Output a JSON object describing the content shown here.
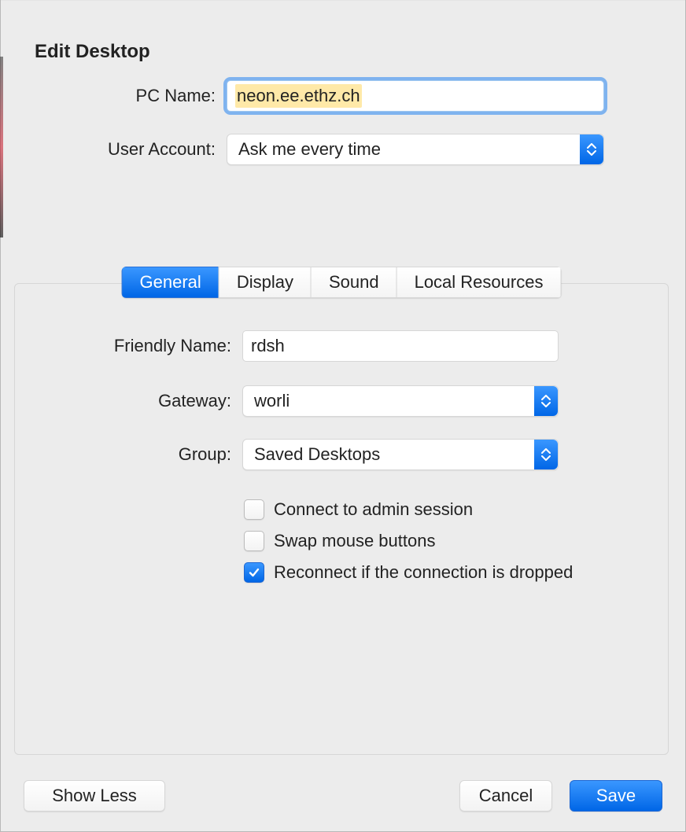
{
  "title": "Edit Desktop",
  "fields": {
    "pc_name": {
      "label": "PC Name:",
      "value": "neon.ee.ethz.ch"
    },
    "user_account": {
      "label": "User Account:",
      "value": "Ask me every time"
    }
  },
  "tabs": {
    "general": "General",
    "display": "Display",
    "sound": "Sound",
    "local_resources": "Local Resources",
    "active": "general"
  },
  "general": {
    "friendly_name": {
      "label": "Friendly Name:",
      "value": "rdsh"
    },
    "gateway": {
      "label": "Gateway:",
      "value": "worli"
    },
    "group": {
      "label": "Group:",
      "value": "Saved Desktops"
    },
    "checkboxes": {
      "admin_session": {
        "label": "Connect to admin session",
        "checked": false
      },
      "swap_mouse": {
        "label": "Swap mouse buttons",
        "checked": false
      },
      "reconnect": {
        "label": "Reconnect if the connection is dropped",
        "checked": true
      }
    }
  },
  "footer": {
    "show_less": "Show Less",
    "cancel": "Cancel",
    "save": "Save"
  }
}
